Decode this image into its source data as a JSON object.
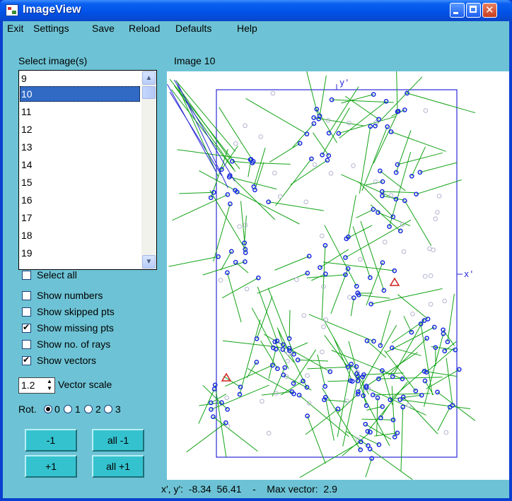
{
  "window": {
    "title": "ImageView"
  },
  "menu": [
    "Exit",
    "Settings",
    "Save",
    "Reload",
    "Defaults",
    "Help"
  ],
  "left": {
    "select_label": "Select image(s)",
    "list_items": [
      "9",
      "10",
      "11",
      "12",
      "13",
      "14",
      "15",
      "16",
      "17",
      "18",
      "19"
    ],
    "selected": "10",
    "checkboxes": [
      {
        "label": "Select all",
        "checked": false
      },
      {
        "label": "Show numbers",
        "checked": false
      },
      {
        "label": "Show skipped pts",
        "checked": false
      },
      {
        "label": "Show missing pts",
        "checked": true
      },
      {
        "label": "Show no. of rays",
        "checked": false
      },
      {
        "label": "Show vectors",
        "checked": true
      }
    ],
    "vector_scale_value": "1.2",
    "vector_scale_label": "Vector scale",
    "rot_label": "Rot.",
    "rot_options": [
      "0",
      "1",
      "2",
      "3"
    ],
    "rot_selected": "0",
    "buttons": {
      "minus": "-1",
      "all_minus": "all -1",
      "plus": "+1",
      "all_plus": "all +1"
    }
  },
  "plot": {
    "title": "Image 10",
    "x_axis_label": "x'",
    "y_axis_label": "y'",
    "colors": {
      "frame": "#2a2ad8",
      "vector": "#13a316",
      "point": "#1a2ae0",
      "missing": "#b4b4d0",
      "marker": "#d02020"
    }
  },
  "status": {
    "text": "x', y':  -8.34  56.41    -    Max vector:  2.9"
  }
}
